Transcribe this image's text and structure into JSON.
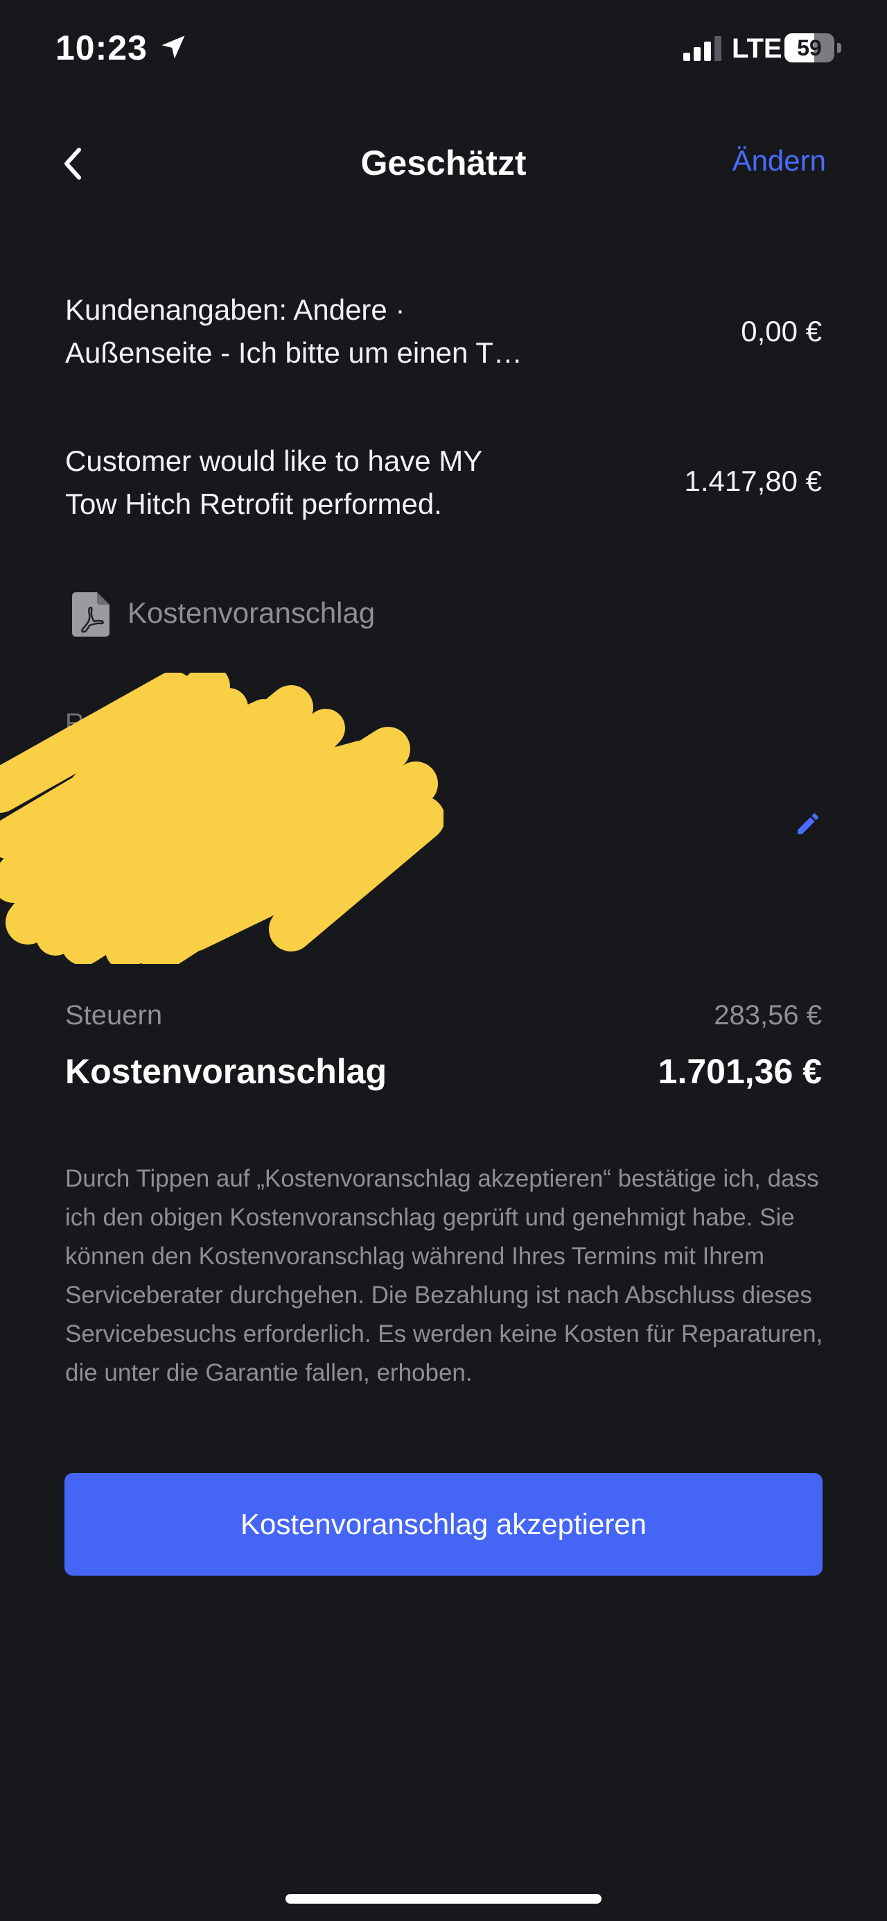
{
  "status_bar": {
    "time": "10:23",
    "network": "LTE",
    "battery": "59"
  },
  "header": {
    "title": "Geschätzt",
    "action_label": "Ändern"
  },
  "line_items": [
    {
      "description_line1": "Kundenangaben: Andere ·",
      "description_line2": "Außenseite - Ich bitte um einen T…",
      "price": "0,00 €"
    },
    {
      "description_line1": "Customer would like to have MY",
      "description_line2": "Tow Hitch Retrofit performed.",
      "price": "1.417,80 €"
    }
  ],
  "estimate_document": {
    "label": "Kostenvoranschlag",
    "icon": "pdf-file-icon"
  },
  "redacted_section": {
    "label_partial": "R                    se"
  },
  "totals": {
    "tax_label": "Steuern",
    "tax_value": "283,56 €",
    "total_label": "Kostenvoranschlag",
    "total_value": "1.701,36 €"
  },
  "disclaimer": "Durch Tippen auf „Kostenvoranschlag akzeptieren“ bestätige ich, dass ich den obigen Kostenvoranschlag geprüft und genehmigt habe. Sie können den Kostenvoranschlag während Ihres Termins mit Ihrem Serviceberater durchgehen. Die Bezahlung ist nach Abschluss dieses Servicebesuchs erforderlich. Es werden keine Kosten für Reparaturen, die unter die Garantie fallen, erhoben.",
  "accept_button_label": "Kostenvoranschlag akzeptieren",
  "colors": {
    "background": "#17181b",
    "accent": "#4566f5",
    "link": "#4a6bff",
    "muted_text": "#8e8f94",
    "redaction": "#f9cf45"
  },
  "icons": {
    "back": "chevron-left-icon",
    "location": "location-arrow-icon",
    "signal": "cellular-signal-icon",
    "battery": "battery-icon",
    "edit": "pencil-icon"
  }
}
